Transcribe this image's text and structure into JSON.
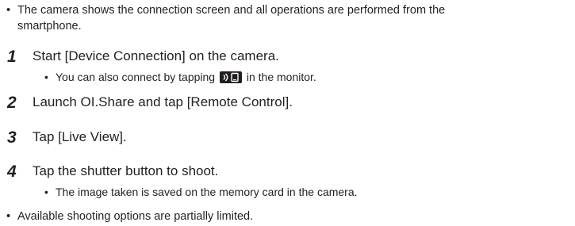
{
  "intro_bullet": {
    "mark": "•",
    "line1": "The camera shows the connection screen and all operations are performed from the",
    "line2": "smartphone."
  },
  "steps": [
    {
      "number": "1",
      "text": "Start [Device Connection] on the camera.",
      "note": {
        "mark": "•",
        "before_icon": "You can also connect by tapping",
        "icon": "device-connection-icon",
        "after_icon": "in the monitor."
      }
    },
    {
      "number": "2",
      "text": "Launch OI.Share and tap [Remote Control]."
    },
    {
      "number": "3",
      "text": "Tap [Live View]."
    },
    {
      "number": "4",
      "text": "Tap the shutter button to shoot.",
      "note": {
        "mark": "•",
        "text": "The image taken is saved on the memory card in the camera."
      }
    }
  ],
  "footer_bullet": {
    "mark": "•",
    "text": "Available shooting options are partially limited."
  },
  "colors": {
    "text": "#231f20",
    "icon_bg": "#231f20",
    "icon_fg": "#ffffff"
  }
}
